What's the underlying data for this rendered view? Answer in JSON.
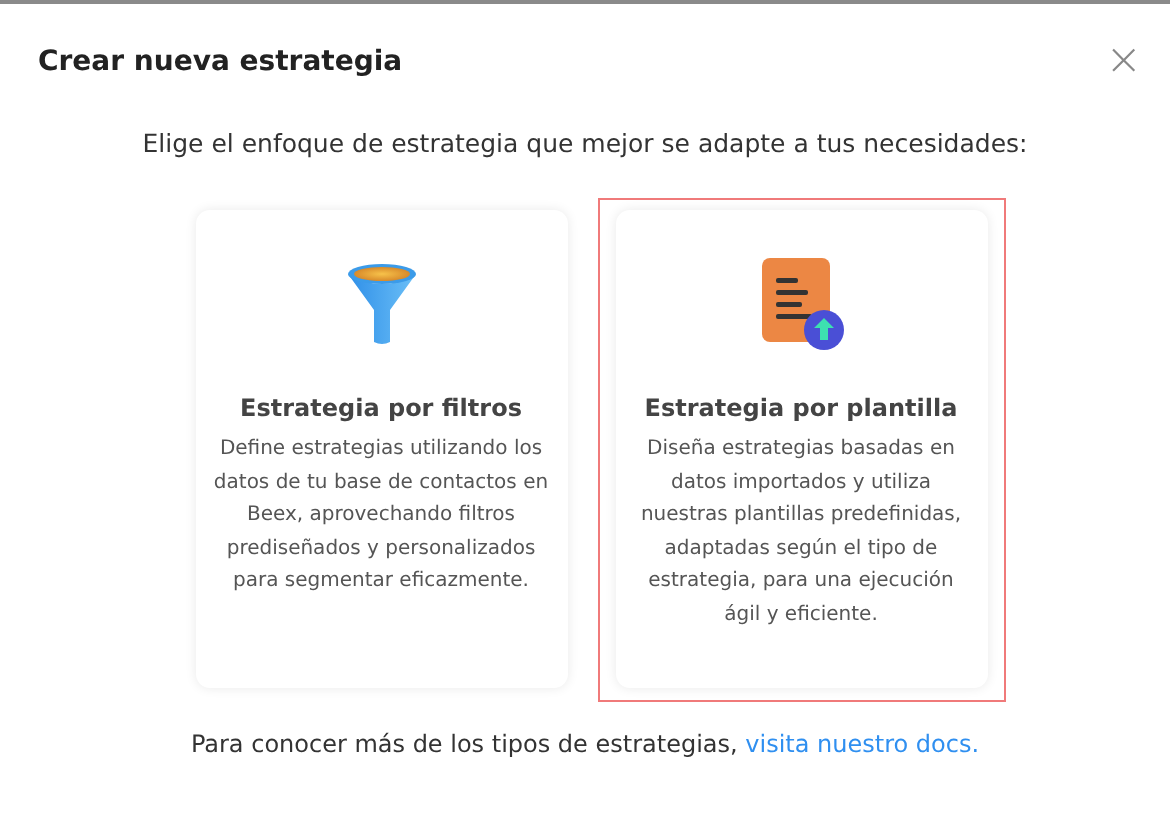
{
  "dialog": {
    "title": "Crear nueva estrategia",
    "close": "×"
  },
  "prompt": "Elige el enfoque de estrategia que mejor se adapte a tus necesidades:",
  "options": [
    {
      "kind": "filter",
      "title": "Estrategia por filtros",
      "description": "Define estrategias utilizando los datos de tu base de contactos en Beex, aprovechando filtros prediseñados y personalizados para segmentar eficazmente.",
      "selected": false
    },
    {
      "kind": "template",
      "title": "Estrategia por plantilla",
      "description": "Diseña estrategias basadas en datos importados y utiliza nuestras plantillas predefinidas, adaptadas según el tipo de estrategia, para una ejecución ágil y eficiente.",
      "selected": true
    }
  ],
  "footer": {
    "text": "Para conocer más de los tipos de estrategias,",
    "link": "visita nuestro docs."
  }
}
